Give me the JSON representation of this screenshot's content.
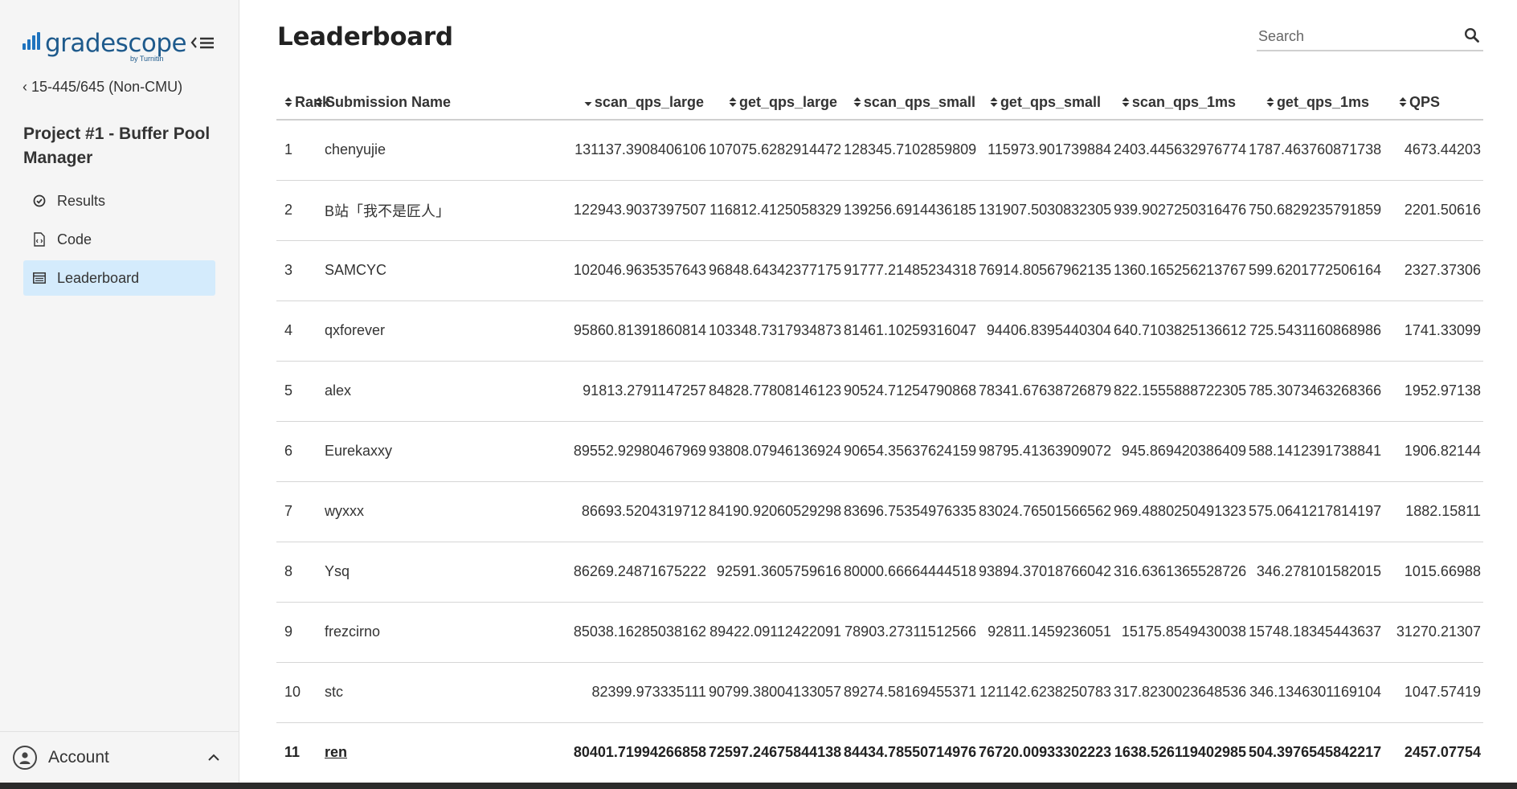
{
  "brand": {
    "name": "gradescope",
    "byline": "by Turnitin"
  },
  "sidebar": {
    "course_link": "15-445/645 (Non-CMU)",
    "project_title": "Project #1 - Buffer Pool Manager",
    "nav": [
      {
        "label": "Results",
        "icon": "check-circle-icon",
        "active": false
      },
      {
        "label": "Code",
        "icon": "code-file-icon",
        "active": false
      },
      {
        "label": "Leaderboard",
        "icon": "leaderboard-icon",
        "active": true
      }
    ],
    "account_label": "Account"
  },
  "main": {
    "title": "Leaderboard",
    "search_placeholder": "Search"
  },
  "table": {
    "columns": [
      "Rank",
      "Submission Name",
      "scan_qps_large",
      "get_qps_large",
      "scan_qps_small",
      "get_qps_small",
      "scan_qps_1ms",
      "get_qps_1ms",
      "QPS"
    ],
    "sorted_column": "scan_qps_large",
    "sort_direction": "desc",
    "rows": [
      [
        "1",
        "chenyujie",
        "131137.3908406106",
        "107075.6282914472",
        "128345.7102859809",
        "115973.901739884",
        "2403.445632976774",
        "1787.463760871738",
        "4673.44203"
      ],
      [
        "2",
        "B站「我不是匠人」",
        "122943.9037397507",
        "116812.4125058329",
        "139256.6914436185",
        "131907.5030832305",
        "939.9027250316476",
        "750.6829235791859",
        "2201.50616"
      ],
      [
        "3",
        "SAMCYC",
        "102046.9635357643",
        "96848.64342377175",
        "91777.21485234318",
        "76914.80567962135",
        "1360.165256213767",
        "599.6201772506164",
        "2327.37306"
      ],
      [
        "4",
        "qxforever",
        "95860.81391860814",
        "103348.7317934873",
        "81461.10259316047",
        "94406.8395440304",
        "640.7103825136612",
        "725.5431160868986",
        "1741.33099"
      ],
      [
        "5",
        "alex",
        "91813.2791147257",
        "84828.77808146123",
        "90524.71254790868",
        "78341.67638726879",
        "822.1555888722305",
        "785.3073463268366",
        "1952.97138"
      ],
      [
        "6",
        "Eurekaxxy",
        "89552.92980467969",
        "93808.07946136924",
        "90654.35637624159",
        "98795.41363909072",
        "945.869420386409",
        "588.1412391738841",
        "1906.82144"
      ],
      [
        "7",
        "wyxxx",
        "86693.5204319712",
        "84190.92060529298",
        "83696.75354976335",
        "83024.76501566562",
        "969.4880250491323",
        "575.0641217814197",
        "1882.15811"
      ],
      [
        "8",
        "Ysq",
        "86269.24871675222",
        "92591.3605759616",
        "80000.66664444518",
        "93894.37018766042",
        "316.6361365528726",
        "346.278101582015",
        "1015.66988"
      ],
      [
        "9",
        "frezcirno",
        "85038.16285038162",
        "89422.09112422091",
        "78903.27311512566",
        "92811.1459236051",
        "15175.8549430038",
        "15748.18345443637",
        "31270.21307"
      ],
      [
        "10",
        "stc",
        "82399.973335111",
        "90799.38004133057",
        "89274.58169455371",
        "121142.6238250783",
        "317.8230023648536",
        "346.1346301169104",
        "1047.57419"
      ],
      [
        "11",
        "ren",
        "80401.71994266858",
        "72597.24675844138",
        "84434.78550714976",
        "76720.00933302223",
        "1638.526119402985",
        "504.3976545842217",
        "2457.07754"
      ]
    ],
    "current_user_row": 10
  }
}
